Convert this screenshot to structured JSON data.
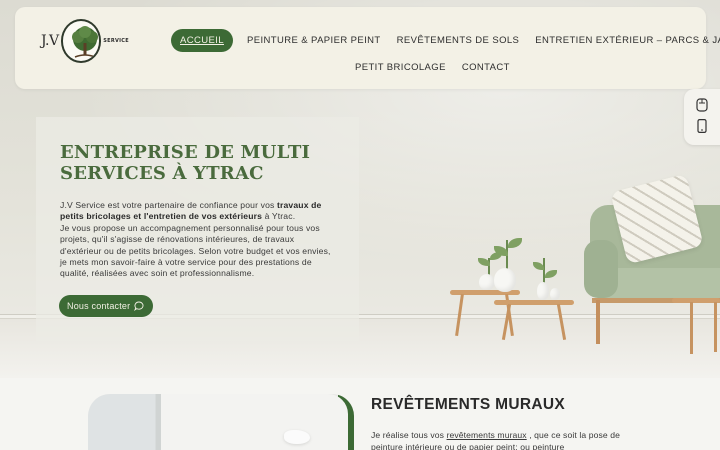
{
  "brand": {
    "logo_text": "J.V",
    "logo_service": "SERVICE"
  },
  "nav": {
    "items": [
      {
        "label": "ACCUEIL",
        "active": true
      },
      {
        "label": "PEINTURE & PAPIER PEINT",
        "active": false
      },
      {
        "label": "REVÊTEMENTS DE SOLS",
        "active": false
      },
      {
        "label": "ENTRETIEN EXTÉRIEUR – PARCS & JARDINS",
        "active": false
      },
      {
        "label": "PETIT BRICOLAGE",
        "active": false
      },
      {
        "label": "CONTACT",
        "active": false
      }
    ]
  },
  "side_tools": {
    "icons": [
      "desktop-icon",
      "mobile-icon"
    ]
  },
  "hero": {
    "title": "ENTREPRISE DE MULTI SERVICES À YTRAC",
    "text_p1_a": "J.V Service est votre partenaire de confiance pour vos ",
    "text_p1_bold": "travaux de petits bricolages et l'entretien de vos extérieurs",
    "text_p1_b": " à Ytrac.",
    "text_p2": "Je vous propose un accompagnement personnalisé pour tous vos projets, qu'il s'agisse de rénovations intérieures, de travaux d'extérieur ou de petits bricolages. Selon votre budget et vos envies, je mets mon savoir-faire à votre service pour des prestations de qualité, réalisées avec soin et professionnalisme.",
    "cta_label": "Nous contacter"
  },
  "section": {
    "title_light": "REVÊTEMENTS ",
    "title_bold": "MURAUX",
    "text_a": "Je réalise tous vos ",
    "text_link": "revêtements muraux",
    "text_b": " , que ce soit la pose de peinture intérieure ou de papier peint; ou peinture"
  },
  "colors": {
    "accent": "#3c6a35",
    "title_green": "#4a6b3d",
    "header_bg": "#f3f1e6"
  }
}
